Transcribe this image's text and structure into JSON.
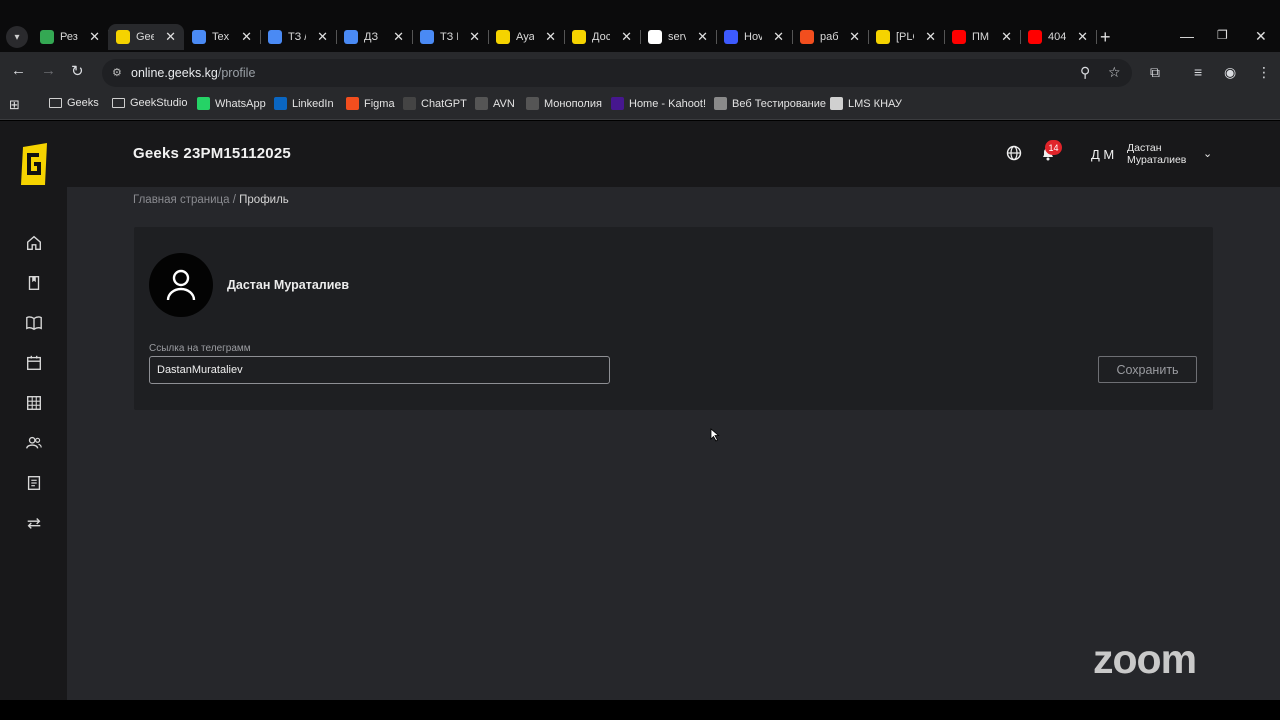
{
  "browser": {
    "tabs": [
      {
        "title": "Рез",
        "fav_color": "#34a853",
        "active": false
      },
      {
        "title": "Gee",
        "fav_color": "#f5d300",
        "active": true
      },
      {
        "title": "Tex",
        "fav_color": "#4a8af4",
        "active": false
      },
      {
        "title": "ТЗ /",
        "fav_color": "#4a8af4",
        "active": false
      },
      {
        "title": "ДЗ",
        "fav_color": "#4a8af4",
        "active": false
      },
      {
        "title": "ТЗ I",
        "fav_color": "#4a8af4",
        "active": false
      },
      {
        "title": "Ауа",
        "fav_color": "#f5d300",
        "active": false
      },
      {
        "title": "Дос",
        "fav_color": "#f5d300",
        "active": false
      },
      {
        "title": "serv",
        "fav_color": "#ffffff",
        "active": false
      },
      {
        "title": "Hov",
        "fav_color": "#3d5afe",
        "active": false
      },
      {
        "title": "раб",
        "fav_color": "#f24e1e",
        "active": false
      },
      {
        "title": "[PLC",
        "fav_color": "#f5d300",
        "active": false
      },
      {
        "title": "ПМ",
        "fav_color": "#ff0000",
        "active": false
      },
      {
        "title": "404",
        "fav_color": "#ff0000",
        "active": false
      }
    ],
    "url_host": "online.geeks.kg",
    "url_path": "/profile",
    "bookmarks": [
      {
        "label": "Geeks",
        "kind": "folder"
      },
      {
        "label": "GeekStudio",
        "kind": "folder"
      },
      {
        "label": "WhatsApp",
        "kind": "icon",
        "color": "#25d366"
      },
      {
        "label": "LinkedIn",
        "kind": "icon",
        "color": "#0a66c2"
      },
      {
        "label": "Figma",
        "kind": "icon",
        "color": "#f24e1e"
      },
      {
        "label": "ChatGPT",
        "kind": "icon",
        "color": "#444444"
      },
      {
        "label": "AVN",
        "kind": "icon",
        "color": "#555555"
      },
      {
        "label": "Монополия",
        "kind": "icon",
        "color": "#555555"
      },
      {
        "label": "Home - Kahoot!",
        "kind": "icon",
        "color": "#46178f"
      },
      {
        "label": "Веб Тестирование",
        "kind": "icon",
        "color": "#8a8a8a"
      },
      {
        "label": "LMS КНАУ",
        "kind": "icon",
        "color": "#d0d0d0"
      }
    ]
  },
  "app": {
    "title": "Geeks 23PM15112025",
    "notifications_count": "14",
    "user_initials": "Д М",
    "user_name_first": "Дастан",
    "user_name_last": "Мураталиев",
    "sidebar_icons": [
      "home-icon",
      "bookmark-icon",
      "book-icon",
      "calendar-icon",
      "table-icon",
      "users-icon",
      "list-icon",
      "swap-icon"
    ]
  },
  "breadcrumb": {
    "home": "Главная страница",
    "separator": " / ",
    "current": "Профиль"
  },
  "profile": {
    "full_name": "Дастан Мураталиев",
    "telegram_label": "Ссылка на телеграмм",
    "telegram_value": "DastanMurataliev",
    "save_label": "Сохранить"
  },
  "overlay": {
    "zoom_watermark": "zoom"
  }
}
